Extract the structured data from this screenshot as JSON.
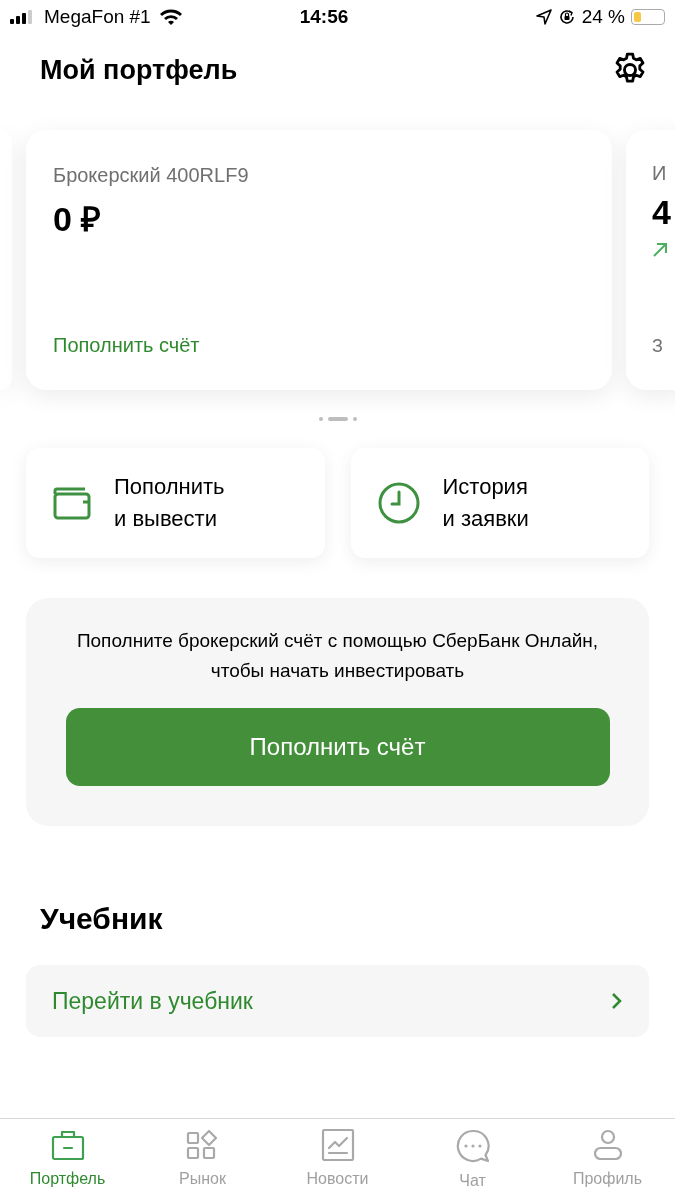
{
  "status_bar": {
    "carrier": "MegaFon #1",
    "time": "14:56",
    "battery": "24 %"
  },
  "header": {
    "title": "Мой портфель"
  },
  "accounts": [
    {
      "kind": "partial_left"
    },
    {
      "kind": "full",
      "title": "Брокерский 400RLF9",
      "value": "0 ₽",
      "link": "Пополнить счёт"
    },
    {
      "kind": "partial_right",
      "title": "И",
      "value": "4",
      "note": "З"
    }
  ],
  "page_dots": [
    {
      "selected": false
    },
    {
      "selected": true
    },
    {
      "selected": false
    }
  ],
  "actions": [
    {
      "kind": "wallet",
      "label": "Пополнить\nи вывести"
    },
    {
      "kind": "clock",
      "label": "История\nи заявки"
    }
  ],
  "promo": {
    "text": "Пополните брокерский счёт с помощью СберБанк Онлайн, чтобы начать инвестировать",
    "button": "Пополнить счёт"
  },
  "tutorial": {
    "title": "Учебник",
    "link": "Перейти в учебник"
  },
  "tab_bar": [
    {
      "kind": "briefcase",
      "label": "Портфель",
      "selected": true
    },
    {
      "kind": "market",
      "label": "Рынок",
      "selected": false
    },
    {
      "kind": "news",
      "label": "Новости",
      "selected": false
    },
    {
      "kind": "chat",
      "label": "Чат",
      "selected": false
    },
    {
      "kind": "profile",
      "label": "Профиль",
      "selected": false
    }
  ]
}
